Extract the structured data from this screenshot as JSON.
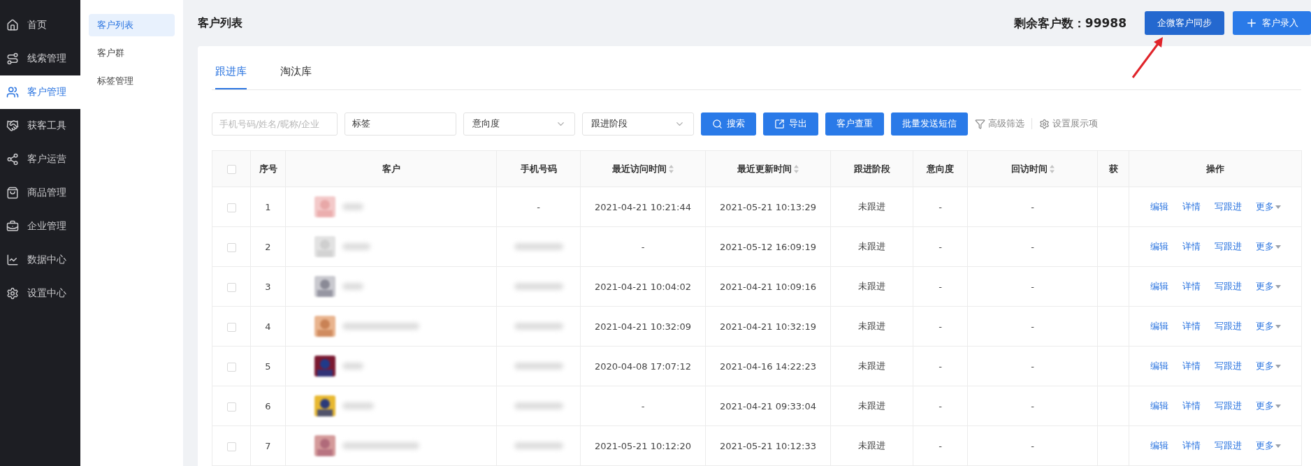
{
  "nav": {
    "items": [
      {
        "label": "首页",
        "selected": false
      },
      {
        "label": "线索管理",
        "selected": false
      },
      {
        "label": "客户管理",
        "selected": true
      },
      {
        "label": "获客工具",
        "selected": false
      },
      {
        "label": "客户运营",
        "selected": false
      },
      {
        "label": "商品管理",
        "selected": false
      },
      {
        "label": "企业管理",
        "selected": false
      },
      {
        "label": "数据中心",
        "selected": false
      },
      {
        "label": "设置中心",
        "selected": false
      }
    ]
  },
  "subnav": {
    "items": [
      {
        "label": "客户列表",
        "selected": true
      },
      {
        "label": "客户群",
        "selected": false
      },
      {
        "label": "标签管理",
        "selected": false
      }
    ]
  },
  "header": {
    "title": "客户列表",
    "remaining": "剩余客户数：99988",
    "sync_button": "企微客户同步",
    "add_button": "客户录入"
  },
  "tabs": [
    {
      "label": "跟进库",
      "selected": true
    },
    {
      "label": "淘汰库",
      "selected": false
    }
  ],
  "filters": {
    "search": {
      "placeholder": "手机号码/姓名/昵称/企业"
    },
    "tag": {
      "value": "标签"
    },
    "selects": [
      {
        "value": "意向度"
      },
      {
        "value": "跟进阶段"
      }
    ],
    "buttons": [
      {
        "kind": "search",
        "label": "搜索"
      },
      {
        "kind": "export",
        "label": "导出"
      },
      {
        "kind": "plain",
        "label": "客户查重"
      },
      {
        "kind": "plain",
        "label": "批量发送短信"
      }
    ],
    "links": [
      {
        "kind": "filter",
        "label": "高级筛选"
      },
      {
        "kind": "settings",
        "label": "设置展示项"
      }
    ]
  },
  "table": {
    "select_all_checked": false,
    "columns": [
      {
        "label": "序号",
        "sortable": false
      },
      {
        "label": "客户",
        "sortable": false
      },
      {
        "label": "手机号码",
        "sortable": false
      },
      {
        "label": "最近访问时间",
        "sortable": true
      },
      {
        "label": "最近更新时间",
        "sortable": true
      },
      {
        "label": "跟进阶段",
        "sortable": false
      },
      {
        "label": "意向度",
        "sortable": false
      },
      {
        "label": "回访时间",
        "sortable": true
      },
      {
        "label": "获",
        "sortable": false
      },
      {
        "label": "操作",
        "sortable": false
      }
    ],
    "rows": [
      {
        "checked": false,
        "index": "1",
        "phone": "-",
        "visit": "2021-04-21 10:21:44",
        "update": "2021-05-21 10:13:29",
        "stage": "未跟进",
        "intent": "-",
        "revisit": "-",
        "actions": [
          "编辑",
          "详情",
          "写跟进",
          "更多"
        ]
      },
      {
        "checked": false,
        "index": "2",
        "visit": "-",
        "update": "2021-05-12 16:09:19",
        "stage": "未跟进",
        "intent": "-",
        "revisit": "-",
        "actions": [
          "编辑",
          "详情",
          "写跟进",
          "更多"
        ]
      },
      {
        "checked": false,
        "index": "3",
        "visit": "2021-04-21 10:04:02",
        "update": "2021-04-21 10:09:16",
        "stage": "未跟进",
        "intent": "-",
        "revisit": "-",
        "actions": [
          "编辑",
          "详情",
          "写跟进",
          "更多"
        ]
      },
      {
        "checked": false,
        "index": "4",
        "visit": "2021-04-21 10:32:09",
        "update": "2021-04-21 10:32:19",
        "stage": "未跟进",
        "intent": "-",
        "revisit": "-",
        "actions": [
          "编辑",
          "详情",
          "写跟进",
          "更多"
        ]
      },
      {
        "checked": false,
        "index": "5",
        "visit": "2020-04-08 17:07:12",
        "update": "2021-04-16 14:22:23",
        "stage": "未跟进",
        "intent": "-",
        "revisit": "-",
        "actions": [
          "编辑",
          "详情",
          "写跟进",
          "更多"
        ]
      },
      {
        "checked": false,
        "index": "6",
        "visit": "-",
        "update": "2021-04-21 09:33:04",
        "stage": "未跟进",
        "intent": "-",
        "revisit": "-",
        "actions": [
          "编辑",
          "详情",
          "写跟进",
          "更多"
        ]
      },
      {
        "checked": false,
        "index": "7",
        "visit": "2021-05-21 10:12:20",
        "update": "2021-05-21 10:12:33",
        "stage": "未跟进",
        "intent": "-",
        "revisit": "-",
        "actions": [
          "编辑",
          "详情",
          "写跟进",
          "更多"
        ]
      }
    ]
  }
}
